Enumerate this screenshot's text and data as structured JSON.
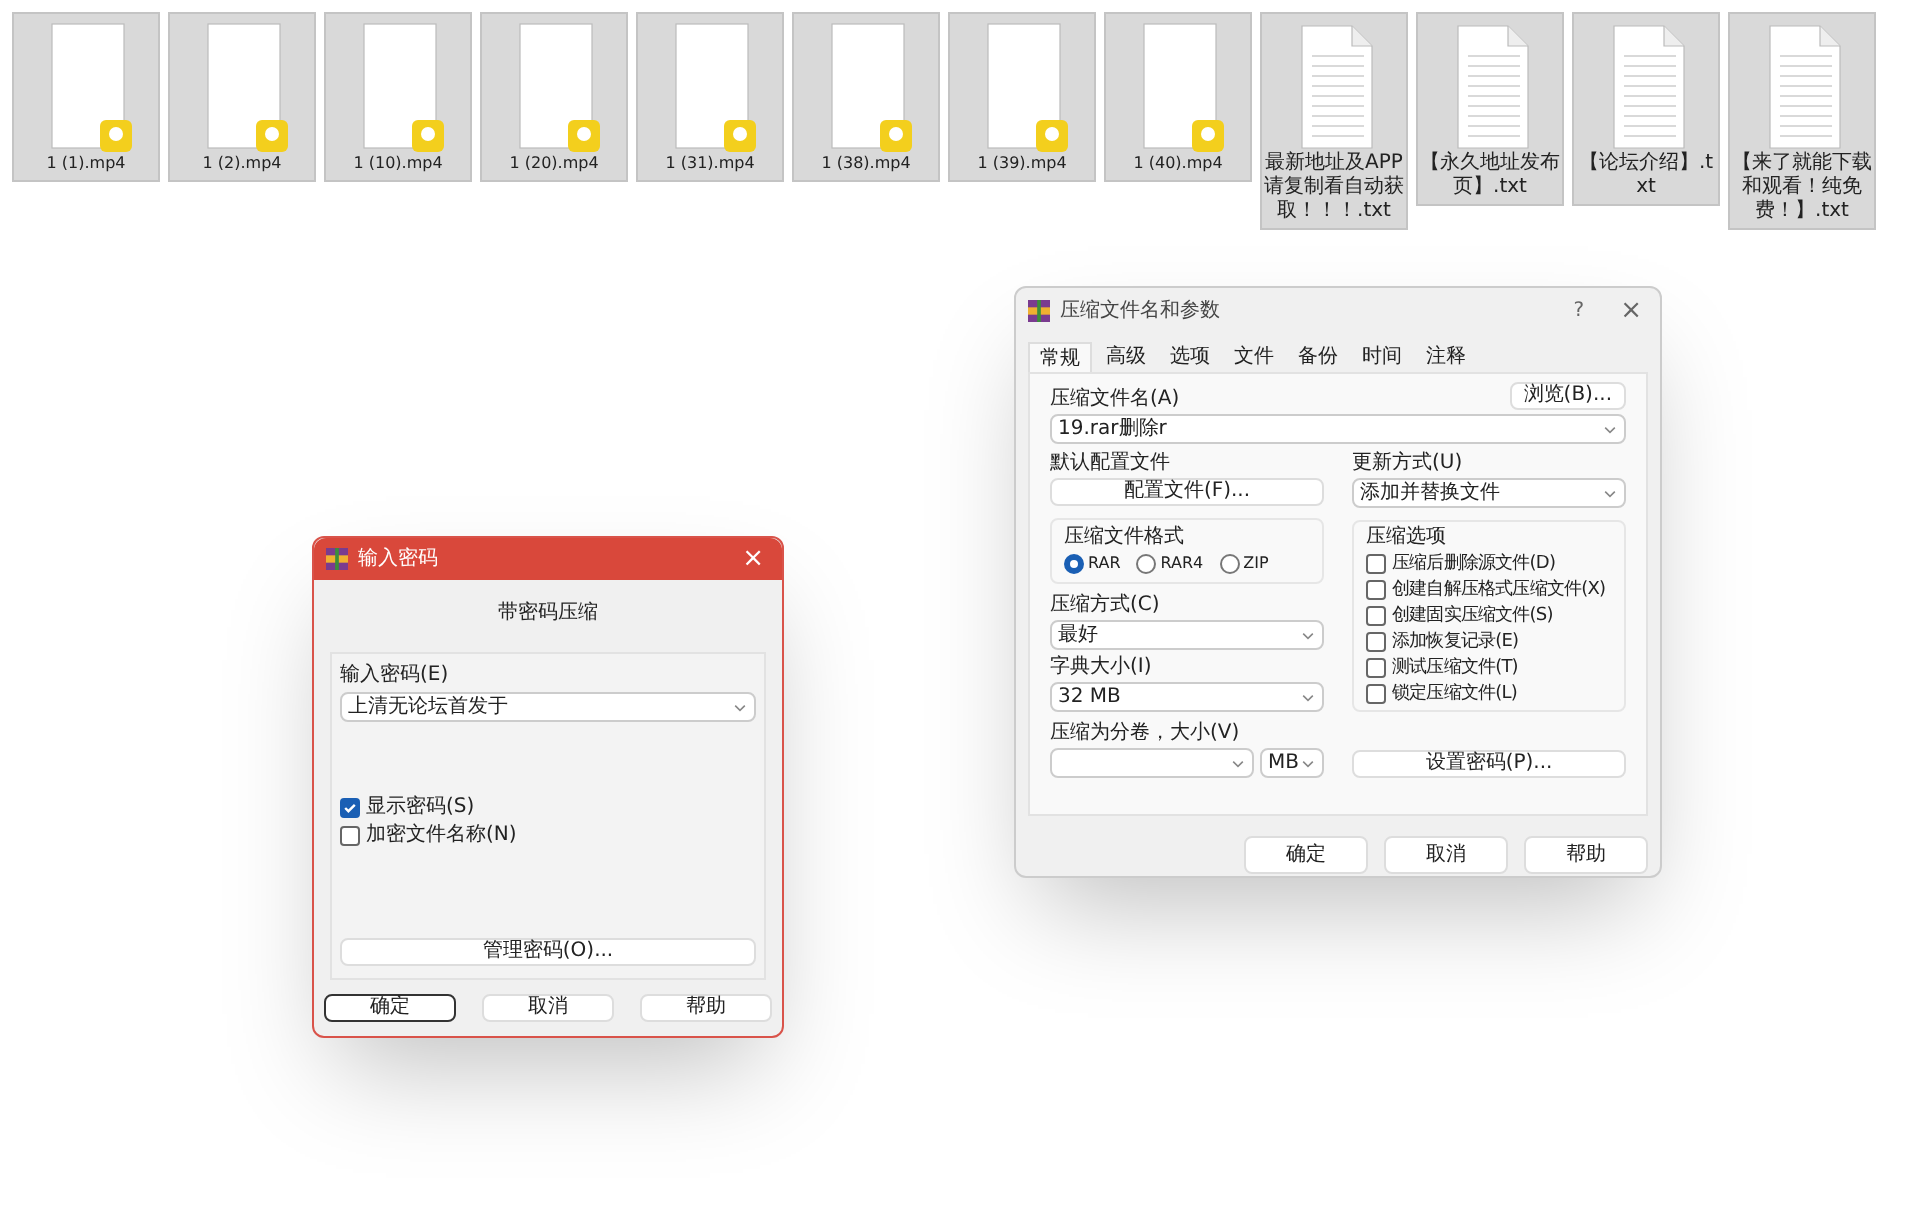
{
  "files": [
    {
      "name": "1 (1).mp4",
      "kind": "video",
      "selected": true
    },
    {
      "name": "1 (2).mp4",
      "kind": "video",
      "selected": true
    },
    {
      "name": "1 (10).mp4",
      "kind": "video",
      "selected": true
    },
    {
      "name": "1 (20).mp4",
      "kind": "video",
      "selected": true
    },
    {
      "name": "1 (31).mp4",
      "kind": "video",
      "selected": true
    },
    {
      "name": "1 (38).mp4",
      "kind": "video",
      "selected": true
    },
    {
      "name": "1 (39).mp4",
      "kind": "video",
      "selected": true
    },
    {
      "name": "1 (40).mp4",
      "kind": "video",
      "selected": true
    },
    {
      "name": "最新地址及APP请复制看自动获取！！！.txt",
      "kind": "text",
      "selected": true
    },
    {
      "name": "【永久地址发布页】.txt",
      "kind": "text",
      "selected": true
    },
    {
      "name": "【论坛介绍】.txt",
      "kind": "text",
      "selected": true
    },
    {
      "name": "【来了就能下载和观看！纯免费！】.txt",
      "kind": "text",
      "selected": true
    }
  ],
  "password_dialog": {
    "title": "输入密码",
    "close": "×",
    "heading": "带密码压缩",
    "field_label": "输入密码(E)",
    "field_value": "上清无论坛首发于",
    "checkboxes": [
      {
        "label": "显示密码(S)",
        "checked": true
      },
      {
        "label": "加密文件名称(N)",
        "checked": false
      }
    ],
    "manage_button": "管理密码(O)...",
    "buttons": [
      {
        "label": "确定",
        "default": true
      },
      {
        "label": "取消",
        "default": false
      },
      {
        "label": "帮助",
        "default": false
      }
    ]
  },
  "archive_dialog": {
    "title": "压缩文件名和参数",
    "help": "?",
    "close": "×",
    "tabs": [
      {
        "label": "常规",
        "selected": true
      },
      {
        "label": "高级",
        "selected": false
      },
      {
        "label": "选项",
        "selected": false
      },
      {
        "label": "文件",
        "selected": false
      },
      {
        "label": "备份",
        "selected": false
      },
      {
        "label": "时间",
        "selected": false
      },
      {
        "label": "注释",
        "selected": false
      }
    ],
    "archive_name_label": "压缩文件名(A)",
    "browse_button": "浏览(B)...",
    "archive_name": "19.rar删除r",
    "profile_label": "默认配置文件",
    "profile_button": "配置文件(F)...",
    "update_label": "更新方式(U)",
    "update_value": "添加并替换文件",
    "format_label": "压缩文件格式",
    "formats": [
      {
        "label": "RAR",
        "selected": true
      },
      {
        "label": "RAR4",
        "selected": false
      },
      {
        "label": "ZIP",
        "selected": false
      }
    ],
    "method_label": "压缩方式(C)",
    "method_value": "最好",
    "dict_label": "字典大小(I)",
    "dict_value": "32 MB",
    "volume_label": "压缩为分卷，大小(V)",
    "volume_unit": "MB",
    "options_label": "压缩选项",
    "options": [
      {
        "label": "压缩后删除源文件(D)",
        "checked": false
      },
      {
        "label": "创建自解压格式压缩文件(X)",
        "checked": false
      },
      {
        "label": "创建固实压缩文件(S)",
        "checked": false
      },
      {
        "label": "添加恢复记录(E)",
        "checked": false
      },
      {
        "label": "测试压缩文件(T)",
        "checked": false
      },
      {
        "label": "锁定压缩文件(L)",
        "checked": false
      }
    ],
    "password_button": "设置密码(P)...",
    "buttons": [
      {
        "label": "确定",
        "default": false
      },
      {
        "label": "取消",
        "default": false
      },
      {
        "label": "帮助",
        "default": false
      }
    ]
  }
}
